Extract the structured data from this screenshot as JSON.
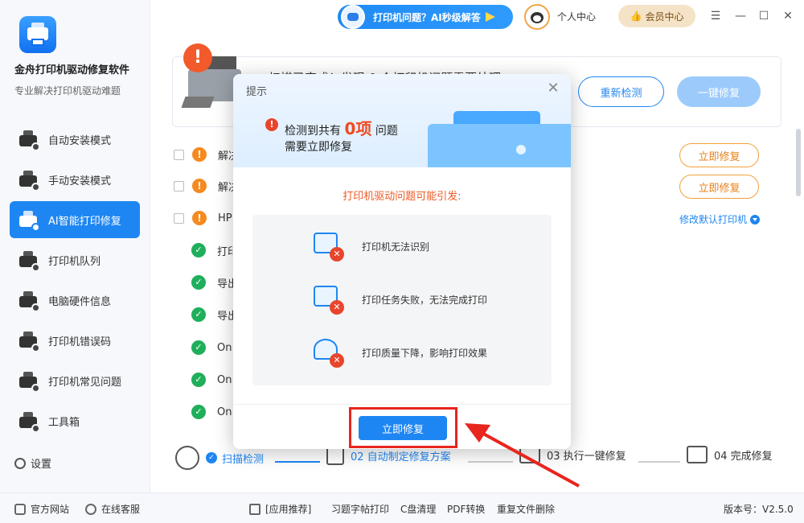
{
  "app": {
    "title": "金舟打印机驱动修复软件",
    "subtitle": "专业解决打印机驱动难题"
  },
  "sidebar": {
    "items": [
      {
        "label": "自动安装模式",
        "icon": "auto-install-icon"
      },
      {
        "label": "手动安装模式",
        "icon": "manual-install-icon"
      },
      {
        "label": "AI智能打印修复",
        "icon": "ai-repair-icon",
        "active": true
      },
      {
        "label": "打印机队列",
        "icon": "printer-queue-icon"
      },
      {
        "label": "电脑硬件信息",
        "icon": "hardware-icon"
      },
      {
        "label": "打印机错误码",
        "icon": "error-code-icon"
      },
      {
        "label": "打印机常见问题",
        "icon": "faq-icon"
      },
      {
        "label": "工具箱",
        "icon": "toolbox-icon"
      }
    ],
    "settings": "设置"
  },
  "topbar": {
    "ai_label": "打印机问题？AI秒级解答",
    "personal": "个人中心",
    "vip": "会员中心"
  },
  "main": {
    "scan_text": "扫描已完成！发现 0 个打印机问题需要处理",
    "recheck": "重新检测",
    "onekey": "一键修复",
    "rows": [
      {
        "status": "warn",
        "text": "解决"
      },
      {
        "status": "warn",
        "text": "解决"
      },
      {
        "status": "warn",
        "text": "HP"
      },
      {
        "status": "ok",
        "text": "打印"
      },
      {
        "status": "ok",
        "text": "导出"
      },
      {
        "status": "ok",
        "text": "导出"
      },
      {
        "status": "ok",
        "text": "On"
      },
      {
        "status": "ok",
        "text": "On"
      },
      {
        "status": "ok",
        "text": "On"
      }
    ],
    "fix_now": "立即修复",
    "change_default": "修改默认打印机"
  },
  "steps": [
    {
      "label": "扫描检测",
      "state": "done"
    },
    {
      "label": "02 自动制定修复方案",
      "state": "current"
    },
    {
      "label": "03 执行一键修复",
      "state": "pending"
    },
    {
      "label": "04 完成修复",
      "state": "pending"
    }
  ],
  "footer": {
    "website": "官方网站",
    "service": "在线客服",
    "recommend": "[应用推荐]",
    "apps": [
      "习题字帖打印",
      "C盘清理",
      "PDF转换",
      "重复文件删除"
    ],
    "version": "版本号：V2.5.0"
  },
  "dialog": {
    "title": "提示",
    "msg_prefix": "检测到共有",
    "count": "0项",
    "msg_suffix": "问题",
    "msg2": "需要立即修复",
    "cause_title": "打印机驱动问题可能引发:",
    "issues": [
      "打印机无法识别",
      "打印任务失败，无法完成打印",
      "打印质量下降，影响打印效果"
    ],
    "fix_button": "立即修复"
  },
  "colors": {
    "accent": "#1e86f2",
    "warn": "#f58a1f",
    "ok": "#1faf5b",
    "danger": "#e8452c",
    "highlight_frame": "#e8251e"
  }
}
